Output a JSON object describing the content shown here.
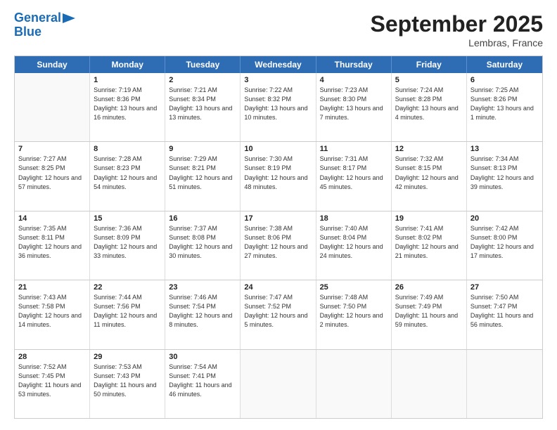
{
  "logo": {
    "line1": "General",
    "line2": "Blue"
  },
  "title": "September 2025",
  "subtitle": "Lembras, France",
  "days_of_week": [
    "Sunday",
    "Monday",
    "Tuesday",
    "Wednesday",
    "Thursday",
    "Friday",
    "Saturday"
  ],
  "weeks": [
    [
      {
        "day": null
      },
      {
        "day": "1",
        "sunrise": "7:19 AM",
        "sunset": "8:36 PM",
        "daylight": "13 hours and 16 minutes."
      },
      {
        "day": "2",
        "sunrise": "7:21 AM",
        "sunset": "8:34 PM",
        "daylight": "13 hours and 13 minutes."
      },
      {
        "day": "3",
        "sunrise": "7:22 AM",
        "sunset": "8:32 PM",
        "daylight": "13 hours and 10 minutes."
      },
      {
        "day": "4",
        "sunrise": "7:23 AM",
        "sunset": "8:30 PM",
        "daylight": "13 hours and 7 minutes."
      },
      {
        "day": "5",
        "sunrise": "7:24 AM",
        "sunset": "8:28 PM",
        "daylight": "13 hours and 4 minutes."
      },
      {
        "day": "6",
        "sunrise": "7:25 AM",
        "sunset": "8:26 PM",
        "daylight": "13 hours and 1 minute."
      }
    ],
    [
      {
        "day": "7",
        "sunrise": "7:27 AM",
        "sunset": "8:25 PM",
        "daylight": "12 hours and 57 minutes."
      },
      {
        "day": "8",
        "sunrise": "7:28 AM",
        "sunset": "8:23 PM",
        "daylight": "12 hours and 54 minutes."
      },
      {
        "day": "9",
        "sunrise": "7:29 AM",
        "sunset": "8:21 PM",
        "daylight": "12 hours and 51 minutes."
      },
      {
        "day": "10",
        "sunrise": "7:30 AM",
        "sunset": "8:19 PM",
        "daylight": "12 hours and 48 minutes."
      },
      {
        "day": "11",
        "sunrise": "7:31 AM",
        "sunset": "8:17 PM",
        "daylight": "12 hours and 45 minutes."
      },
      {
        "day": "12",
        "sunrise": "7:32 AM",
        "sunset": "8:15 PM",
        "daylight": "12 hours and 42 minutes."
      },
      {
        "day": "13",
        "sunrise": "7:34 AM",
        "sunset": "8:13 PM",
        "daylight": "12 hours and 39 minutes."
      }
    ],
    [
      {
        "day": "14",
        "sunrise": "7:35 AM",
        "sunset": "8:11 PM",
        "daylight": "12 hours and 36 minutes."
      },
      {
        "day": "15",
        "sunrise": "7:36 AM",
        "sunset": "8:09 PM",
        "daylight": "12 hours and 33 minutes."
      },
      {
        "day": "16",
        "sunrise": "7:37 AM",
        "sunset": "8:08 PM",
        "daylight": "12 hours and 30 minutes."
      },
      {
        "day": "17",
        "sunrise": "7:38 AM",
        "sunset": "8:06 PM",
        "daylight": "12 hours and 27 minutes."
      },
      {
        "day": "18",
        "sunrise": "7:40 AM",
        "sunset": "8:04 PM",
        "daylight": "12 hours and 24 minutes."
      },
      {
        "day": "19",
        "sunrise": "7:41 AM",
        "sunset": "8:02 PM",
        "daylight": "12 hours and 21 minutes."
      },
      {
        "day": "20",
        "sunrise": "7:42 AM",
        "sunset": "8:00 PM",
        "daylight": "12 hours and 17 minutes."
      }
    ],
    [
      {
        "day": "21",
        "sunrise": "7:43 AM",
        "sunset": "7:58 PM",
        "daylight": "12 hours and 14 minutes."
      },
      {
        "day": "22",
        "sunrise": "7:44 AM",
        "sunset": "7:56 PM",
        "daylight": "12 hours and 11 minutes."
      },
      {
        "day": "23",
        "sunrise": "7:46 AM",
        "sunset": "7:54 PM",
        "daylight": "12 hours and 8 minutes."
      },
      {
        "day": "24",
        "sunrise": "7:47 AM",
        "sunset": "7:52 PM",
        "daylight": "12 hours and 5 minutes."
      },
      {
        "day": "25",
        "sunrise": "7:48 AM",
        "sunset": "7:50 PM",
        "daylight": "12 hours and 2 minutes."
      },
      {
        "day": "26",
        "sunrise": "7:49 AM",
        "sunset": "7:49 PM",
        "daylight": "11 hours and 59 minutes."
      },
      {
        "day": "27",
        "sunrise": "7:50 AM",
        "sunset": "7:47 PM",
        "daylight": "11 hours and 56 minutes."
      }
    ],
    [
      {
        "day": "28",
        "sunrise": "7:52 AM",
        "sunset": "7:45 PM",
        "daylight": "11 hours and 53 minutes."
      },
      {
        "day": "29",
        "sunrise": "7:53 AM",
        "sunset": "7:43 PM",
        "daylight": "11 hours and 50 minutes."
      },
      {
        "day": "30",
        "sunrise": "7:54 AM",
        "sunset": "7:41 PM",
        "daylight": "11 hours and 46 minutes."
      },
      {
        "day": null
      },
      {
        "day": null
      },
      {
        "day": null
      },
      {
        "day": null
      }
    ]
  ]
}
